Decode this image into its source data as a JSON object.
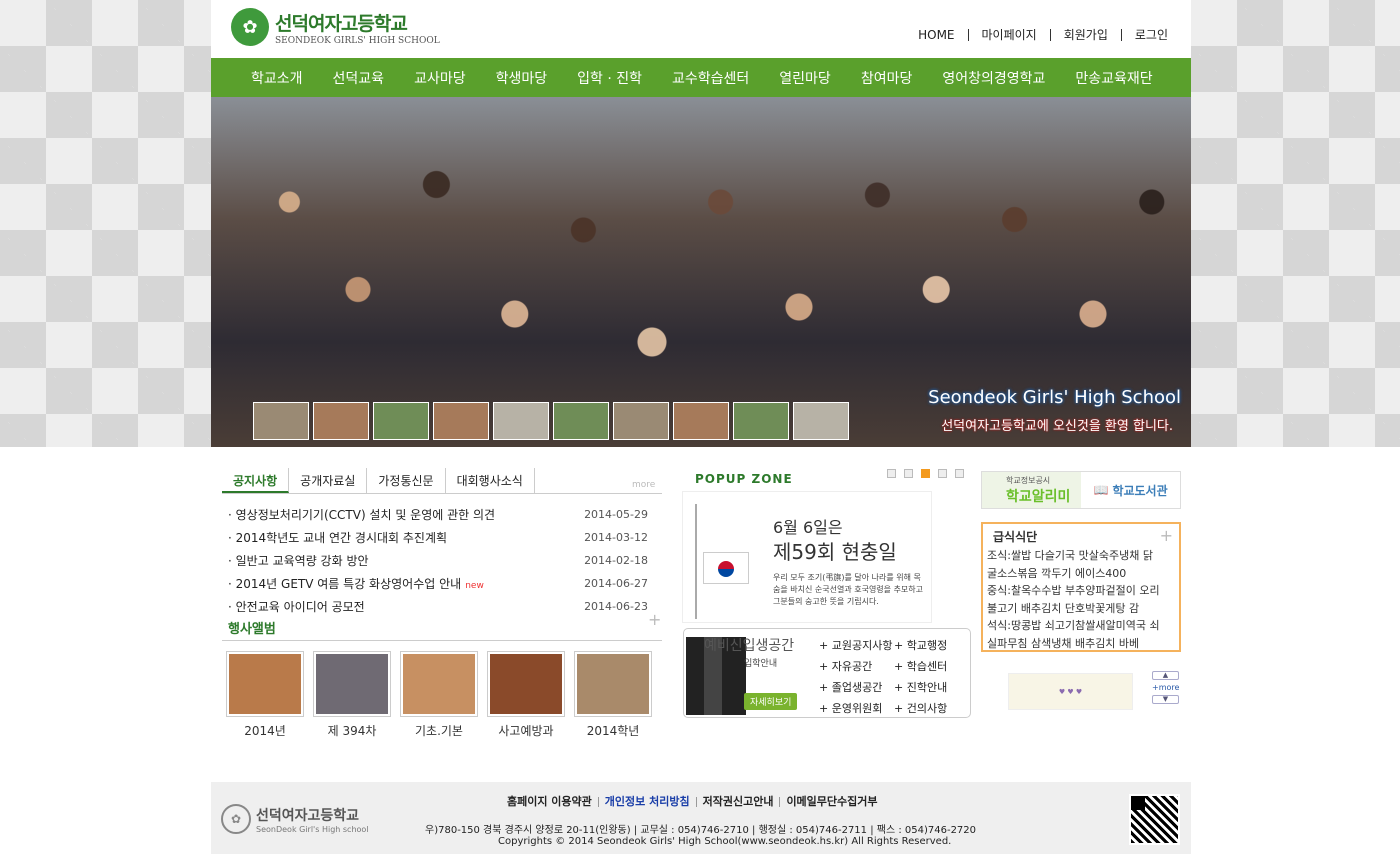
{
  "header": {
    "logo_ko": "선덕여자고등학교",
    "logo_en": "SEONDEOK GIRLS' HIGH SCHOOL",
    "util_links": [
      "HOME",
      "마이페이지",
      "회원가입",
      "로그인"
    ]
  },
  "gnb": [
    "학교소개",
    "선덕교육",
    "교사마당",
    "학생마당",
    "입학 · 진학",
    "교수학습센터",
    "열린마당",
    "참여마당",
    "영어창의경영학교",
    "만송교육재단"
  ],
  "hero": {
    "caption_en": "Seondeok Girls' High School",
    "caption_ko": "선덕여자고등학교에 오신것을 환영 합니다."
  },
  "board": {
    "tabs": [
      "공지사항",
      "공개자료실",
      "가정통신문",
      "대회행사소식"
    ],
    "more": "more",
    "items": [
      {
        "title": "영상정보처리기기(CCTV) 설치 및 운영에 관한 의견",
        "date": "2014-05-29",
        "new": ""
      },
      {
        "title": "2014학년도 교내 연간 경시대회 추진계획",
        "date": "2014-03-12",
        "new": ""
      },
      {
        "title": "일반고 교육역량 강화 방안",
        "date": "2014-02-18",
        "new": ""
      },
      {
        "title": "2014년 GETV 여름 특강 화상영어수업 안내",
        "date": "2014-06-27",
        "new": "new"
      },
      {
        "title": "안전교육 아이디어 공모전",
        "date": "2014-06-23",
        "new": ""
      }
    ]
  },
  "album": {
    "title": "행사앨범",
    "items": [
      "2014년",
      "제 394차",
      "기초.기본",
      "사고예방과",
      "2014학년"
    ]
  },
  "popup": {
    "title": "POPUP ZONE",
    "date_line": "6월 6일은",
    "main_line": "제59회 현충일",
    "text": "우리 모두 조기(弔旗)를 달아 나라를 위해 목숨을 바치신 순국선열과 호국영령을 추모하고 그분들의 숭고한 뜻을 기립시다."
  },
  "new_students": {
    "title": "예비신입생공간",
    "sub": "입학안내",
    "button": "자세히보기",
    "links": [
      "교원공지사항",
      "학교행정",
      "자유공간",
      "학습센터",
      "졸업생공간",
      "진학안내",
      "운영위원회",
      "건의사항"
    ]
  },
  "banners": {
    "info_small": "학교정보공시",
    "info_big": "학교알리미",
    "library": "학교도서관"
  },
  "meal": {
    "title": "급식식단",
    "lines": [
      "조식:쌀밥 다슬기국 맛살숙주냉채 닭",
      "굴소스볶음 깍두기 에이스400",
      "중식:찰옥수수밥 부추양파겉절이 오리",
      "불고기 배추김치 단호박꽃게탕 감",
      "석식:땅콩밥 쇠고기참쌀새알미역국 쇠",
      "실파무침 삼색냉채 배추김치 바베"
    ]
  },
  "side_more": "+more",
  "footer": {
    "logo_ko": "선덕여자고등학교",
    "logo_en": "SeonDeok Girl's High school",
    "links": [
      "홈페이지 이용약관",
      "개인정보 처리방침",
      "저작권신고안내",
      "이메일무단수집거부"
    ],
    "address": "우)780-150 경북 경주시 양정로 20-11(인왕동) | 교무실 : 054)746-2710 | 행정실 : 054)746-2711 | 팩스 : 054)746-2720",
    "copyright": "Copyrights © 2014 Seondeok Girls' High School(www.seondeok.hs.kr) All Rights Reserved."
  }
}
